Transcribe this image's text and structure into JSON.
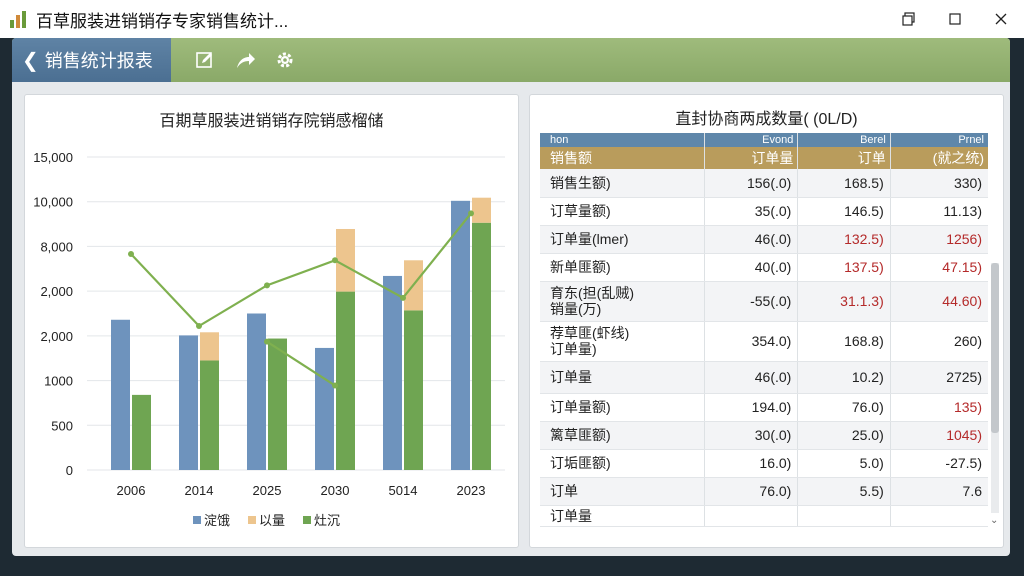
{
  "window": {
    "title": "百草服装进销销存专家销售统计...",
    "icon": "bar-chart-app-icon",
    "buttons": [
      "restore-icon",
      "maximize-icon",
      "close-icon"
    ]
  },
  "toolbar": {
    "back_label": "销售统计报表",
    "icons": [
      "edit-icon",
      "share-icon",
      "gear-icon"
    ],
    "background": "#8aa968",
    "back_color": "#4b6f92"
  },
  "chart_data": {
    "type": "bar",
    "title": "百期草服装进销销存院销感榴储",
    "categories": [
      "2006",
      "2014",
      "2025",
      "2030",
      "5014",
      "2023"
    ],
    "yticks": [
      "0",
      "500",
      "1000",
      "2,000",
      "2,000",
      "8,000",
      "10,000",
      "15,000"
    ],
    "series": [
      {
        "name": "淀饿",
        "type": "bar",
        "values": [
          2400,
          2150,
          2500,
          1950,
          3100,
          4300
        ],
        "color": "#6e93bd"
      },
      {
        "name": "以量",
        "type": "stack",
        "values": [
          0,
          450,
          0,
          1000,
          800,
          400
        ],
        "color": "#edc58e"
      },
      {
        "name": "灶沉",
        "type": "bar",
        "values": [
          1200,
          1750,
          2100,
          2850,
          2550,
          3950
        ],
        "color": "#6fa552"
      },
      {
        "type": "line",
        "values": [
          3450,
          2300,
          2950,
          3350,
          2750,
          4100
        ],
        "color": "#7fb04f"
      }
    ],
    "line2": {
      "values": [
        2050,
        1350
      ],
      "categories": [
        "2025",
        "2030"
      ]
    },
    "legend_position": "bottom"
  },
  "table": {
    "title": "直封协商两成数量( (0L/D)",
    "header_top": [
      "hon",
      "Evond",
      "Berel",
      "Prnel"
    ],
    "header": [
      "销售额",
      "订单量",
      "订单",
      "(就之统)"
    ],
    "rows": [
      {
        "label": "销售生额)",
        "c1": "156(.0)",
        "c2": "168.5)",
        "c3": "330)",
        "red2": false,
        "red3": false
      },
      {
        "label": "订草量额)",
        "c1": "35(.0)",
        "c2": "146.5)",
        "c3": "11.13)",
        "red2": false,
        "red3": false
      },
      {
        "label": "订单量(lmer)",
        "c1": "46(.0)",
        "c2": "132.5)",
        "c3": "1256)",
        "red2": true,
        "red3": true
      },
      {
        "label": "新单匪额)",
        "c1": "40(.0)",
        "c2": "137.5)",
        "c3": "47.15)",
        "red2": true,
        "red3": true
      },
      {
        "label": "育东(担(乱贼)\n销量(万)",
        "c1": "-55(.0)",
        "c2": "31.1.3)",
        "c3": "44.60)",
        "red2": true,
        "red3": true
      },
      {
        "label": "荐草匪(虾线)\n订单量)",
        "c1": "354.0)",
        "c2": "168.8)",
        "c3": "260)",
        "red2": false,
        "red3": false
      },
      {
        "label": "订单量",
        "c1": "46(.0)",
        "c2": "10.2)",
        "c3": "2725)",
        "red2": false,
        "red3": false
      },
      {
        "label": "订单量额)",
        "c1": "194.0)",
        "c2": "76.0)",
        "c3": "135)",
        "red2": false,
        "red3": true
      },
      {
        "label": "篱草匪额)",
        "c1": "30(.0)",
        "c2": "25.0)",
        "c3": "1045)",
        "red2": false,
        "red3": true
      },
      {
        "label": "订垢匪额)",
        "c1": "16.0)",
        "c2": "5.0)",
        "c3": "-27.5)",
        "red2": false,
        "red3": false
      },
      {
        "label": "订单",
        "c1": "76.0)",
        "c2": "5.5)",
        "c3": "7.6",
        "red2": false,
        "red3": false
      },
      {
        "label": "订单量",
        "c1": "",
        "c2": "",
        "c3": "",
        "red2": false,
        "red3": false
      }
    ]
  }
}
